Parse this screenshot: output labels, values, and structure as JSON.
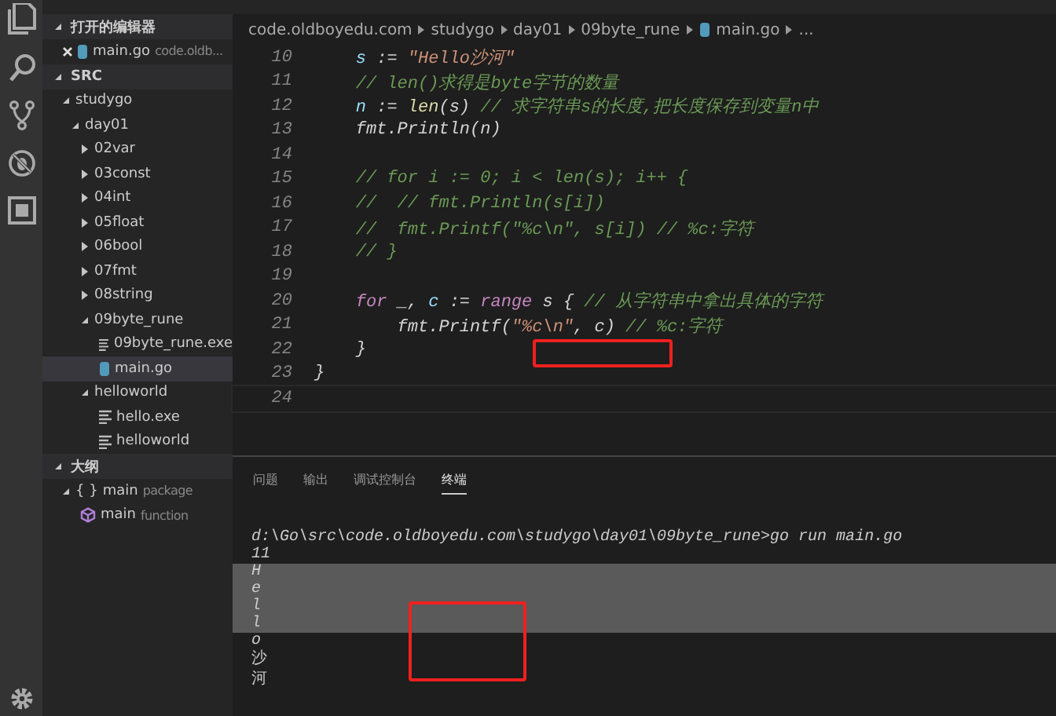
{
  "sidebar": {
    "open_editors": {
      "title": "打开的编辑器",
      "expanded": true,
      "items": [
        {
          "label": "main.go",
          "path": "code.oldb..."
        }
      ]
    },
    "explorer": {
      "title": "SRC",
      "expanded": true,
      "tree": [
        {
          "label": "studygo",
          "kind": "folder",
          "expanded": true,
          "selected": false,
          "children": [
            {
              "label": "day01",
              "kind": "folder",
              "expanded": true,
              "selected": false,
              "children": [
                {
                  "label": "02var",
                  "kind": "folder",
                  "expanded": false,
                  "selected": false
                },
                {
                  "label": "03const",
                  "kind": "folder",
                  "expanded": false,
                  "selected": false
                },
                {
                  "label": "04int",
                  "kind": "folder",
                  "expanded": false,
                  "selected": false
                },
                {
                  "label": "05float",
                  "kind": "folder",
                  "expanded": false,
                  "selected": false
                },
                {
                  "label": "06bool",
                  "kind": "folder",
                  "expanded": false,
                  "selected": false
                },
                {
                  "label": "07fmt",
                  "kind": "folder",
                  "expanded": false,
                  "selected": false
                },
                {
                  "label": "08string",
                  "kind": "folder",
                  "expanded": false,
                  "selected": false
                },
                {
                  "label": "09byte_rune",
                  "kind": "folder",
                  "expanded": true,
                  "selected": false,
                  "children": [
                    {
                      "label": "09byte_rune.exe",
                      "kind": "file",
                      "selected": false
                    },
                    {
                      "label": "main.go",
                      "kind": "go",
                      "selected": true
                    }
                  ]
                },
                {
                  "label": "helloworld",
                  "kind": "folder",
                  "expanded": true,
                  "selected": false,
                  "children": [
                    {
                      "label": "hello.exe",
                      "kind": "file",
                      "selected": false
                    },
                    {
                      "label": "helloworld",
                      "kind": "file",
                      "selected": false
                    }
                  ]
                }
              ]
            }
          ]
        }
      ]
    },
    "outline": {
      "title": "大纲",
      "expanded": true,
      "tree": [
        {
          "label": "main",
          "detail": "package",
          "kind": "package",
          "icon": "{ }",
          "expanded": true,
          "children": [
            {
              "label": "main",
              "detail": "function",
              "kind": "function"
            }
          ]
        }
      ]
    }
  },
  "breadcrumb": [
    "code.oldboyedu.com",
    "studygo",
    "day01",
    "09byte_rune",
    "main.go",
    "..."
  ],
  "code_lines": [
    {
      "number": "10",
      "tokens": [
        {
          "text": "    s",
          "kind": "var"
        },
        {
          "text": " := ",
          "kind": "plain"
        },
        {
          "text": "\"Hello沙河\"",
          "kind": "string"
        }
      ]
    },
    {
      "number": "11",
      "tokens": [
        {
          "text": "    // len()求得是byte字节的数量",
          "kind": "comment"
        }
      ]
    },
    {
      "number": "12",
      "tokens": [
        {
          "text": "    n",
          "kind": "var"
        },
        {
          "text": " := ",
          "kind": "plain"
        },
        {
          "text": "len",
          "kind": "func"
        },
        {
          "text": "(s) ",
          "kind": "plain"
        },
        {
          "text": "// 求字符串s的长度,把长度保存到变量n中",
          "kind": "comment"
        }
      ]
    },
    {
      "number": "13",
      "tokens": [
        {
          "text": "    fmt.Println(n)",
          "kind": "plain"
        }
      ]
    },
    {
      "number": "14"
    },
    {
      "number": "15",
      "tokens": [
        {
          "text": "    // for i := 0; i < len(s); i++ {",
          "kind": "comment"
        }
      ]
    },
    {
      "number": "16",
      "tokens": [
        {
          "text": "    //  // fmt.Println(s[i])",
          "kind": "comment"
        }
      ]
    },
    {
      "number": "17",
      "tokens": [
        {
          "text": "    //  fmt.Printf(\"%c\\n\", s[i]) // %c:字符",
          "kind": "comment"
        }
      ]
    },
    {
      "number": "18",
      "tokens": [
        {
          "text": "    // }",
          "kind": "comment"
        }
      ]
    },
    {
      "number": "19"
    },
    {
      "number": "20",
      "tokens": [
        {
          "text": "    for",
          "kind": "keyword"
        },
        {
          "text": " _, ",
          "kind": "plain"
        },
        {
          "text": "c",
          "kind": "var"
        },
        {
          "text": " := ",
          "kind": "plain"
        },
        {
          "text": "range",
          "kind": "keyword"
        },
        {
          "text": " s { ",
          "kind": "plain"
        },
        {
          "text": "// 从字符串中拿出具体的字符",
          "kind": "comment"
        }
      ]
    },
    {
      "number": "21",
      "tokens": [
        {
          "text": "        fmt.Printf(",
          "kind": "plain"
        },
        {
          "text": "\"%c\\n\"",
          "kind": "string"
        },
        {
          "text": ", c) ",
          "kind": "plain"
        },
        {
          "text": "// %c:字符",
          "kind": "comment"
        }
      ]
    },
    {
      "number": "22",
      "tokens": [
        {
          "text": "    }",
          "kind": "plain"
        }
      ]
    },
    {
      "number": "23",
      "tokens": [
        {
          "text": "}",
          "kind": "plain"
        }
      ]
    },
    {
      "number": "24"
    }
  ],
  "panel_tabs": [
    {
      "label": "问题",
      "selected": false
    },
    {
      "label": "输出",
      "selected": false
    },
    {
      "label": "调试控制台",
      "selected": false
    },
    {
      "label": "终端",
      "selected": true
    }
  ],
  "terminal_lines": [
    {
      "text": "d:\\Go\\src\\code.oldboyedu.com\\studygo\\day01\\09byte_rune>go run main.go",
      "selected": false
    },
    {
      "text": "11",
      "selected": false
    },
    {
      "text": "H",
      "selected": true
    },
    {
      "text": "e",
      "selected": true
    },
    {
      "text": "l",
      "selected": true
    },
    {
      "text": "l",
      "selected": true
    },
    {
      "text": "o",
      "selected": false
    },
    {
      "text": "沙",
      "selected": false
    },
    {
      "text": "河",
      "selected": false
    }
  ]
}
